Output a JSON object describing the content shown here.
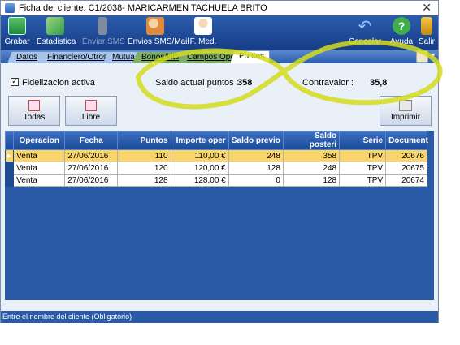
{
  "window": {
    "title": "Ficha del cliente: C1/2038- MARICARMEN TACHUELA BRITO",
    "close_glyph": "✕"
  },
  "toolbar": {
    "grabar": "Grabar",
    "estadistica": "Estadistica",
    "enviar_sms": "Enviar SMS",
    "envios_sms_mail": "Envios SMS/Mail",
    "f_med": "F. Med.",
    "cancelar": "Cancelar",
    "ayuda": "Ayuda",
    "salir": "Salir"
  },
  "tabs": [
    "Datos",
    "Financiero/Otros",
    "Mutua",
    "Bonos/kits",
    "Campos Opc.",
    "Puntos"
  ],
  "panel": {
    "fidelizacion_checked": "✓",
    "fidelizacion_label": "Fidelizacion activa",
    "saldo_label": "Saldo actual puntos :",
    "saldo_value": "358",
    "contravalor_label": "Contravalor :",
    "contravalor_value": "35,8",
    "todas_label": "Todas",
    "libre_label": "Libre",
    "imprimir_label": "Imprimir"
  },
  "table": {
    "headers": [
      "Operacion",
      "Fecha",
      "Puntos",
      "Importe oper",
      "Saldo previo",
      "Saldo posteri",
      "Serie",
      "Document"
    ],
    "rows": [
      [
        "Venta",
        "27/06/2016",
        "110",
        "110,00 €",
        "248",
        "358",
        "TPV",
        "20676"
      ],
      [
        "Venta",
        "27/06/2016",
        "120",
        "120,00 €",
        "128",
        "248",
        "TPV",
        "20675"
      ],
      [
        "Venta",
        "27/06/2016",
        "128",
        "128,00 €",
        "0",
        "128",
        "TPV",
        "20674"
      ]
    ],
    "row_indicator": "▶"
  },
  "statusbar": {
    "text": "Entre el nombre del cliente (Obligatorio)"
  },
  "colors": {
    "toolbar": "#173d86",
    "selected_row": "#f9d56a",
    "highlight_marker": "#d4dc1e"
  },
  "icons": [
    "app-icon",
    "save-icon",
    "chart-icon",
    "phone-icon",
    "users-icon",
    "doctor-icon",
    "undo-icon",
    "help-icon",
    "exit-icon",
    "user-icon",
    "printer-icon"
  ]
}
